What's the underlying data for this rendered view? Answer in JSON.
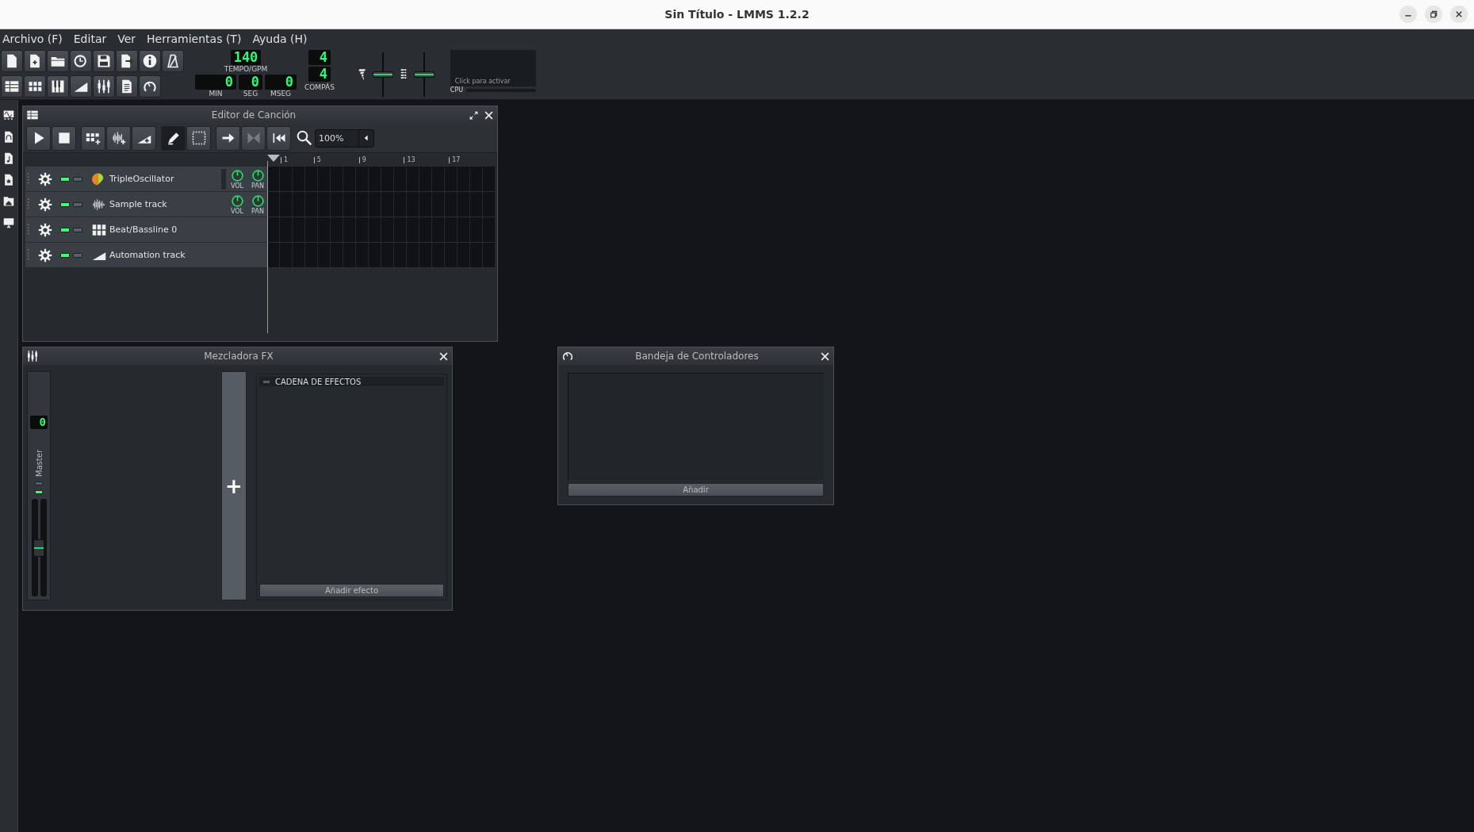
{
  "window": {
    "title": "Sin Título - LMMS 1.2.2"
  },
  "menu": [
    "Archivo (F)",
    "Editar",
    "Ver",
    "Herramientas (T)",
    "Ayuda (H)"
  ],
  "toolbar": {
    "tempo": {
      "value": "140",
      "label": "TEMPO/GPM"
    },
    "time": [
      {
        "value": "0",
        "label": "MIN"
      },
      {
        "value": "0",
        "label": "SEG"
      },
      {
        "value": "0",
        "label": "MSEG"
      }
    ],
    "time_signature": {
      "numerator": "4",
      "denominator": "4",
      "label": "COMPÁS"
    },
    "master_volume": {
      "level": 0.5
    },
    "master_pitch": {
      "level": 0.5
    },
    "cpu": {
      "hint": "Click para activar",
      "label": "CPU"
    }
  },
  "song_editor": {
    "title": "Editor de Canción",
    "tools": [
      {
        "kind": "play",
        "selected": false,
        "disabled": false
      },
      {
        "kind": "stop",
        "selected": false,
        "disabled": false
      },
      {
        "kind": "add-beat",
        "selected": false,
        "disabled": false
      },
      {
        "kind": "add-sample",
        "selected": false,
        "disabled": false
      },
      {
        "kind": "add-automation",
        "selected": false,
        "disabled": false
      },
      {
        "kind": "draw",
        "selected": true,
        "disabled": false
      },
      {
        "kind": "select",
        "selected": false,
        "disabled": false
      },
      {
        "kind": "follow",
        "selected": false,
        "disabled": false
      },
      {
        "kind": "auto-scroll",
        "selected": false,
        "disabled": true
      },
      {
        "kind": "loop-back",
        "selected": false,
        "disabled": false
      }
    ],
    "zoom": "100%",
    "ruler": [
      "1",
      "5",
      "9",
      "13",
      "17"
    ],
    "tracks": [
      {
        "kind": "instrument",
        "name": "TripleOscillator",
        "muted": false,
        "solo": false,
        "knobs": [
          "VOL",
          "PAN"
        ]
      },
      {
        "kind": "sample",
        "name": "Sample track",
        "muted": false,
        "solo": false,
        "knobs": [
          "VOL",
          "PAN"
        ]
      },
      {
        "kind": "beat",
        "name": "Beat/Bassline 0",
        "muted": false,
        "solo": false
      },
      {
        "kind": "automation",
        "name": "Automation track",
        "muted": false,
        "solo": false
      }
    ]
  },
  "fx_mixer": {
    "title": "Mezcladora FX",
    "master": {
      "number": "0",
      "name": "Master",
      "solo": false,
      "muted": false,
      "level": 0.5
    },
    "add_channel": "+",
    "effects_chain": {
      "title": "CADENA DE EFECTOS",
      "enabled": false,
      "button": "Añadir efecto"
    }
  },
  "controller_rack": {
    "title": "Bandeja de Controladores",
    "button": "Añadir"
  }
}
